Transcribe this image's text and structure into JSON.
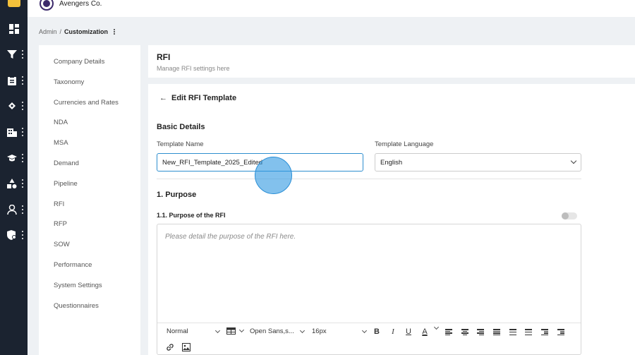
{
  "company": {
    "name": "Avengers Co."
  },
  "breadcrumb": {
    "root": "Admin",
    "sep": "/",
    "current": "Customization"
  },
  "sidebar": {
    "items": [
      {
        "label": "Company Details"
      },
      {
        "label": "Taxonomy"
      },
      {
        "label": "Currencies and Rates"
      },
      {
        "label": "NDA"
      },
      {
        "label": "MSA"
      },
      {
        "label": "Demand"
      },
      {
        "label": "Pipeline"
      },
      {
        "label": "RFI"
      },
      {
        "label": "RFP"
      },
      {
        "label": "SOW"
      },
      {
        "label": "Performance"
      },
      {
        "label": "System Settings"
      },
      {
        "label": "Questionnaires"
      }
    ]
  },
  "rail": {
    "icons": [
      "dashboard-icon",
      "filter-icon",
      "clipboard-icon",
      "handshake-icon",
      "building-icon",
      "graduation-cap-icon",
      "shapes-icon",
      "user-icon",
      "shield-gear-icon"
    ]
  },
  "header": {
    "title": "RFI",
    "subtitle": "Manage RFI settings here"
  },
  "form": {
    "back_arrow": "←",
    "title": "Edit RFI Template",
    "section_basic": "Basic Details",
    "template_name_label": "Template Name",
    "template_name_value": "New_RFI_Template_2025_Edited",
    "template_language_label": "Template Language",
    "template_language_value": "English",
    "section_purpose": "1. Purpose",
    "purpose_sub": "1.1. Purpose of the RFI",
    "purpose_placeholder": "Please detail the purpose of the RFI here."
  },
  "toolbar": {
    "style": "Normal",
    "font": "Open Sans,s...",
    "size": "16px",
    "bold": "B",
    "italic": "I",
    "underline": "U",
    "color": "A"
  },
  "colors": {
    "rail_bg": "#1b2330",
    "accent": "#2e8ecf",
    "page_bg": "#eef1f4"
  }
}
